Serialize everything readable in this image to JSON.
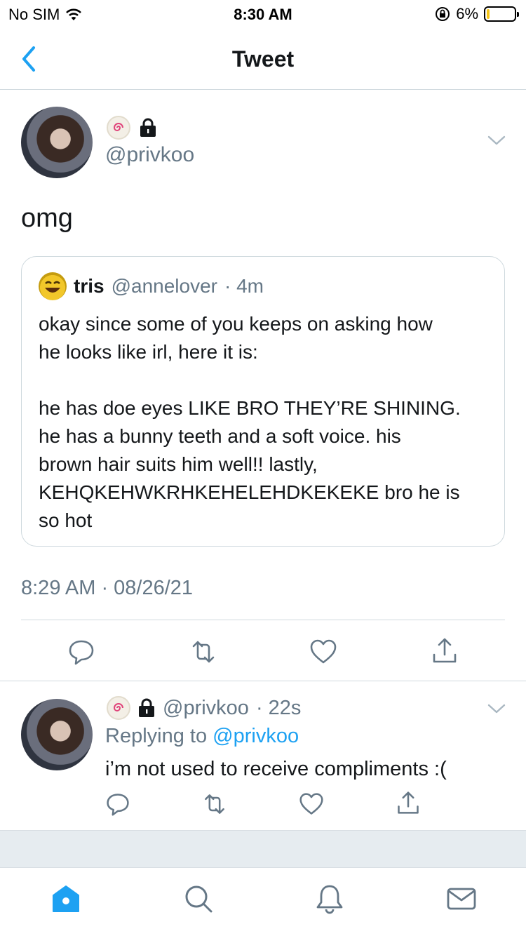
{
  "status_bar": {
    "carrier": "No SIM",
    "time": "8:30 AM",
    "battery_percent": "6%"
  },
  "nav": {
    "title": "Tweet"
  },
  "tweet": {
    "handle": "@privkoo",
    "text": "omg",
    "quote": {
      "name": "tris",
      "handle": "@annelover",
      "age": "· 4m",
      "body": "okay since some of you keeps on asking how\nhe looks like irl, here it is:\n\nhe has doe eyes LIKE BRO THEY’RE SHINING.\nhe has a bunny teeth and a soft voice. his\nbrown hair suits him well!! lastly,\nKEHQKEHWKRHKEHELEHDKEKEKE bro he is\nso hot"
    },
    "timestamp": "8:29 AM · 08/26/21"
  },
  "reply": {
    "handle": "@privkoo",
    "age": "· 22s",
    "replying_prefix": "Replying to ",
    "replying_mention": "@privkoo",
    "text": "i’m not used to receive compliments :("
  },
  "colors": {
    "accent": "#1da1f2",
    "secondary_text": "#657786",
    "divider": "#cfd9de",
    "battery": "#f5c518"
  },
  "icons": {
    "back": "chevron-left-icon",
    "reply": "comment-icon",
    "retweet": "retweet-icon",
    "like": "heart-icon",
    "share": "share-icon",
    "home": "home-icon",
    "search": "search-icon",
    "notifications": "bell-icon",
    "messages": "mail-icon"
  }
}
